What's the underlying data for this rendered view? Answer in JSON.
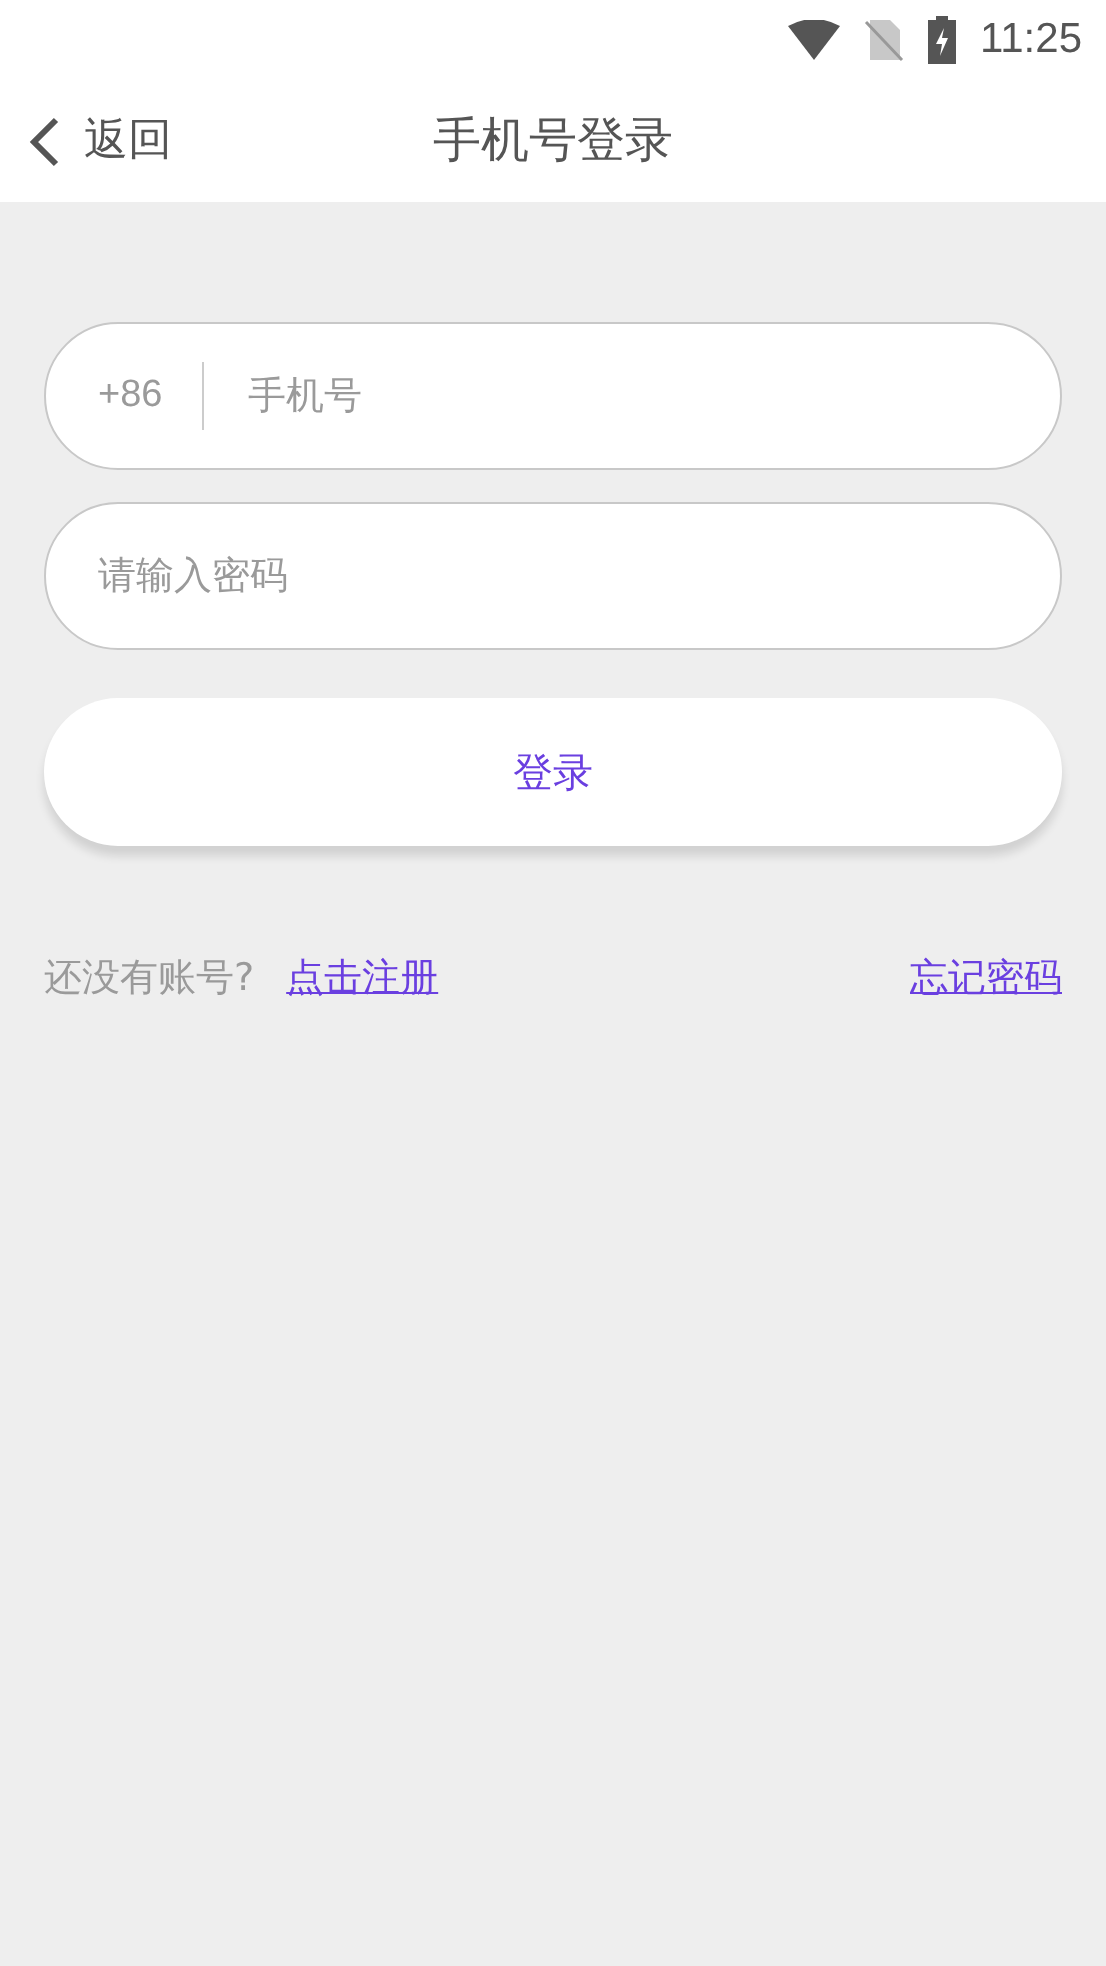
{
  "status_bar": {
    "time": "11:25"
  },
  "header": {
    "back_label": "返回",
    "title": "手机号登录"
  },
  "phone_field": {
    "country_code": "+86",
    "placeholder": "手机号"
  },
  "password_field": {
    "placeholder": "请输入密码"
  },
  "login_button": "登录",
  "footer": {
    "prompt": "还没有账号?",
    "register_link": "点击注册",
    "forgot_link": "忘记密码"
  }
}
